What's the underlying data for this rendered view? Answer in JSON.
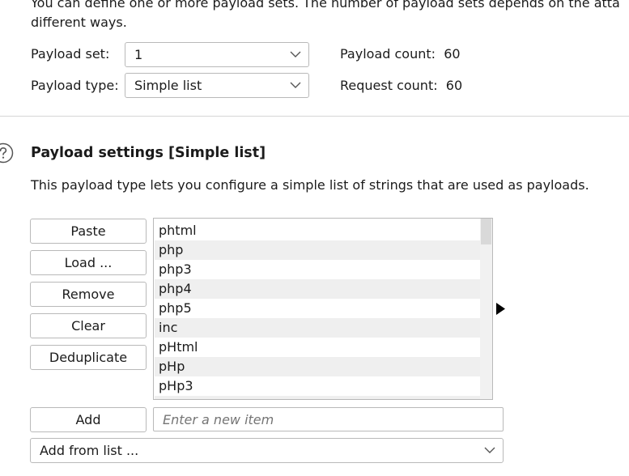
{
  "intro": {
    "line1": "You can define one or more payload sets. The number of payload sets depends on the attack type defined in the Positions tab. Various payload types are available for each payload set, and each payload type can be customized in different ways.",
    "line1_visible": "You can define one or more payload sets. The number of payload sets depends on the atta",
    "line2": "different ways."
  },
  "payload_set": {
    "label": "Payload set:",
    "value": "1"
  },
  "payload_type": {
    "label": "Payload type:",
    "value": "Simple list"
  },
  "payload_count": {
    "label": "Payload count:",
    "value": "60"
  },
  "request_count": {
    "label": "Request count:",
    "value": "60"
  },
  "settings": {
    "title": "Payload settings [Simple list]",
    "description": "This payload type lets you configure a simple list of strings that are used as payloads."
  },
  "buttons": {
    "paste": "Paste",
    "load": "Load ...",
    "remove": "Remove",
    "clear": "Clear",
    "deduplicate": "Deduplicate",
    "add": "Add"
  },
  "payload_list": [
    "phtml",
    "php",
    "php3",
    "php4",
    "php5",
    "inc",
    "pHtml",
    "pHp",
    "pHp3"
  ],
  "add_input": {
    "placeholder": "Enter a new item"
  },
  "add_from_list": {
    "label": "Add from list ..."
  },
  "colors": {
    "border": "#b9b9b9",
    "alt_row": "#efefef",
    "text": "#1b1b1b"
  }
}
